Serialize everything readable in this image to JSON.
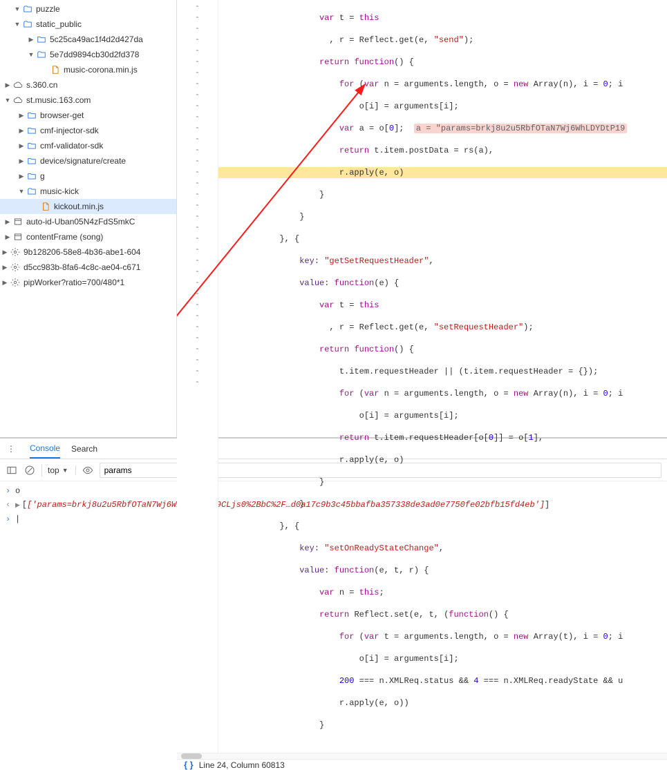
{
  "tree": {
    "puzzle": "puzzle",
    "static_public": "static_public",
    "sp1": "5c25ca49ac1f4d2d427da",
    "sp2": "5e7dd9894cb30d2fd378",
    "sp2_file": "music-corona.min.js",
    "s360": "s.360.cn",
    "stmusic": "st.music.163.com",
    "browser_get": "browser-get",
    "cmf_inj": "cmf-injector-sdk",
    "cmf_val": "cmf-validator-sdk",
    "device_sig": "device/signature/create",
    "g": "g",
    "music_kick": "music-kick",
    "kickout": "kickout.min.js",
    "autoid": "auto-id-Uban05N4zFdS5mkC",
    "contentframe": "contentFrame (song)",
    "hash1": "9b128206-58e8-4b36-abe1-604",
    "hash2": "d5cc983b-8fa6-4c8c-ae04-c671",
    "pip": "pipWorker?ratio=700/480*1"
  },
  "code": {
    "inline_a": "a = \"params=brkj8u2u5RbfOTaN7Wj6WhLDYDtP19"
  },
  "status": {
    "braces": "{ }",
    "text": "Line 24, Column 60813"
  },
  "drawer": {
    "tabs": {
      "console": "Console",
      "search": "Search"
    },
    "context": "top",
    "filter": "params",
    "rows": {
      "r1": "o",
      "r2": "['params=brkj8u2u5RbfOTaN7Wj6WhLDYDtP19CLjs0%2BbC%2F…d0a17c9b3c45bbafba357338de3ad0e7750fe02bfb15fd4eb']"
    }
  }
}
